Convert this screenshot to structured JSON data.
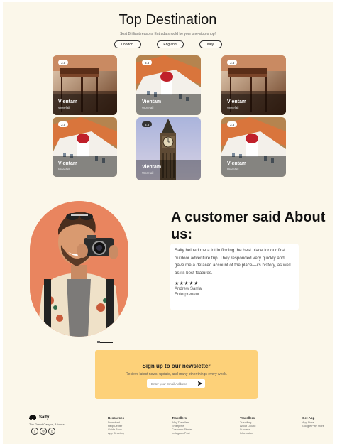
{
  "destinations": {
    "title": "Top Destination",
    "subtitle": "Sost Brilliant reasons Entrada should be your one-stop-shop!",
    "filters": [
      "London",
      "England",
      "Italy"
    ],
    "cards": [
      {
        "rating": "3.5",
        "name": "Vientam",
        "sub": "Worefall"
      },
      {
        "rating": "3.5",
        "name": "Vientam",
        "sub": "Worefall"
      },
      {
        "rating": "3.5",
        "name": "Vientam",
        "sub": "Worefall"
      },
      {
        "rating": "3.5",
        "name": "Vientam",
        "sub": "Worefall"
      },
      {
        "rating": "3.5",
        "name": "Vientam",
        "sub": "Worefall"
      },
      {
        "rating": "3.5",
        "name": "Vientam",
        "sub": "Worefall"
      }
    ]
  },
  "testimonial": {
    "title": "A customer said About us:",
    "quote": "Salty helped me a lot in finding the best place for our first outdoor adventure trip. They responded very quickly and gave me a detailed account of the place—its history, as well as its best features.",
    "stars": "★★★★★",
    "name": "Andrew Sarria",
    "role": "Enterpreneur"
  },
  "newsletter": {
    "title": "Sign up to our newsletter",
    "subtitle": "Recieve latest news, update, and many other things every week.",
    "placeholder": "Enter your Email Address"
  },
  "footer": {
    "brand": "Salty",
    "address": "The Grand Canyon, Arizona",
    "social": [
      "f",
      "◎",
      "t"
    ],
    "columns": [
      {
        "heading": "Resources",
        "items": [
          "Download",
          "Help Center",
          "Guide Book",
          "App Directory"
        ]
      },
      {
        "heading": "Travellers",
        "items": [
          "Why Travellers",
          "Enterprise",
          "Customer Stories",
          "Instagram Post"
        ]
      },
      {
        "heading": "Travellers",
        "items": [
          "Travelling",
          "About Locato",
          "Success",
          "Information"
        ]
      },
      {
        "heading": "Get App",
        "items": [
          "App Store",
          "Google Play Store"
        ]
      }
    ]
  },
  "colors": {
    "page_bg": "#fbf7ea",
    "newsletter_bg": "#fdd179",
    "portrait_bg": "#e9855f"
  }
}
